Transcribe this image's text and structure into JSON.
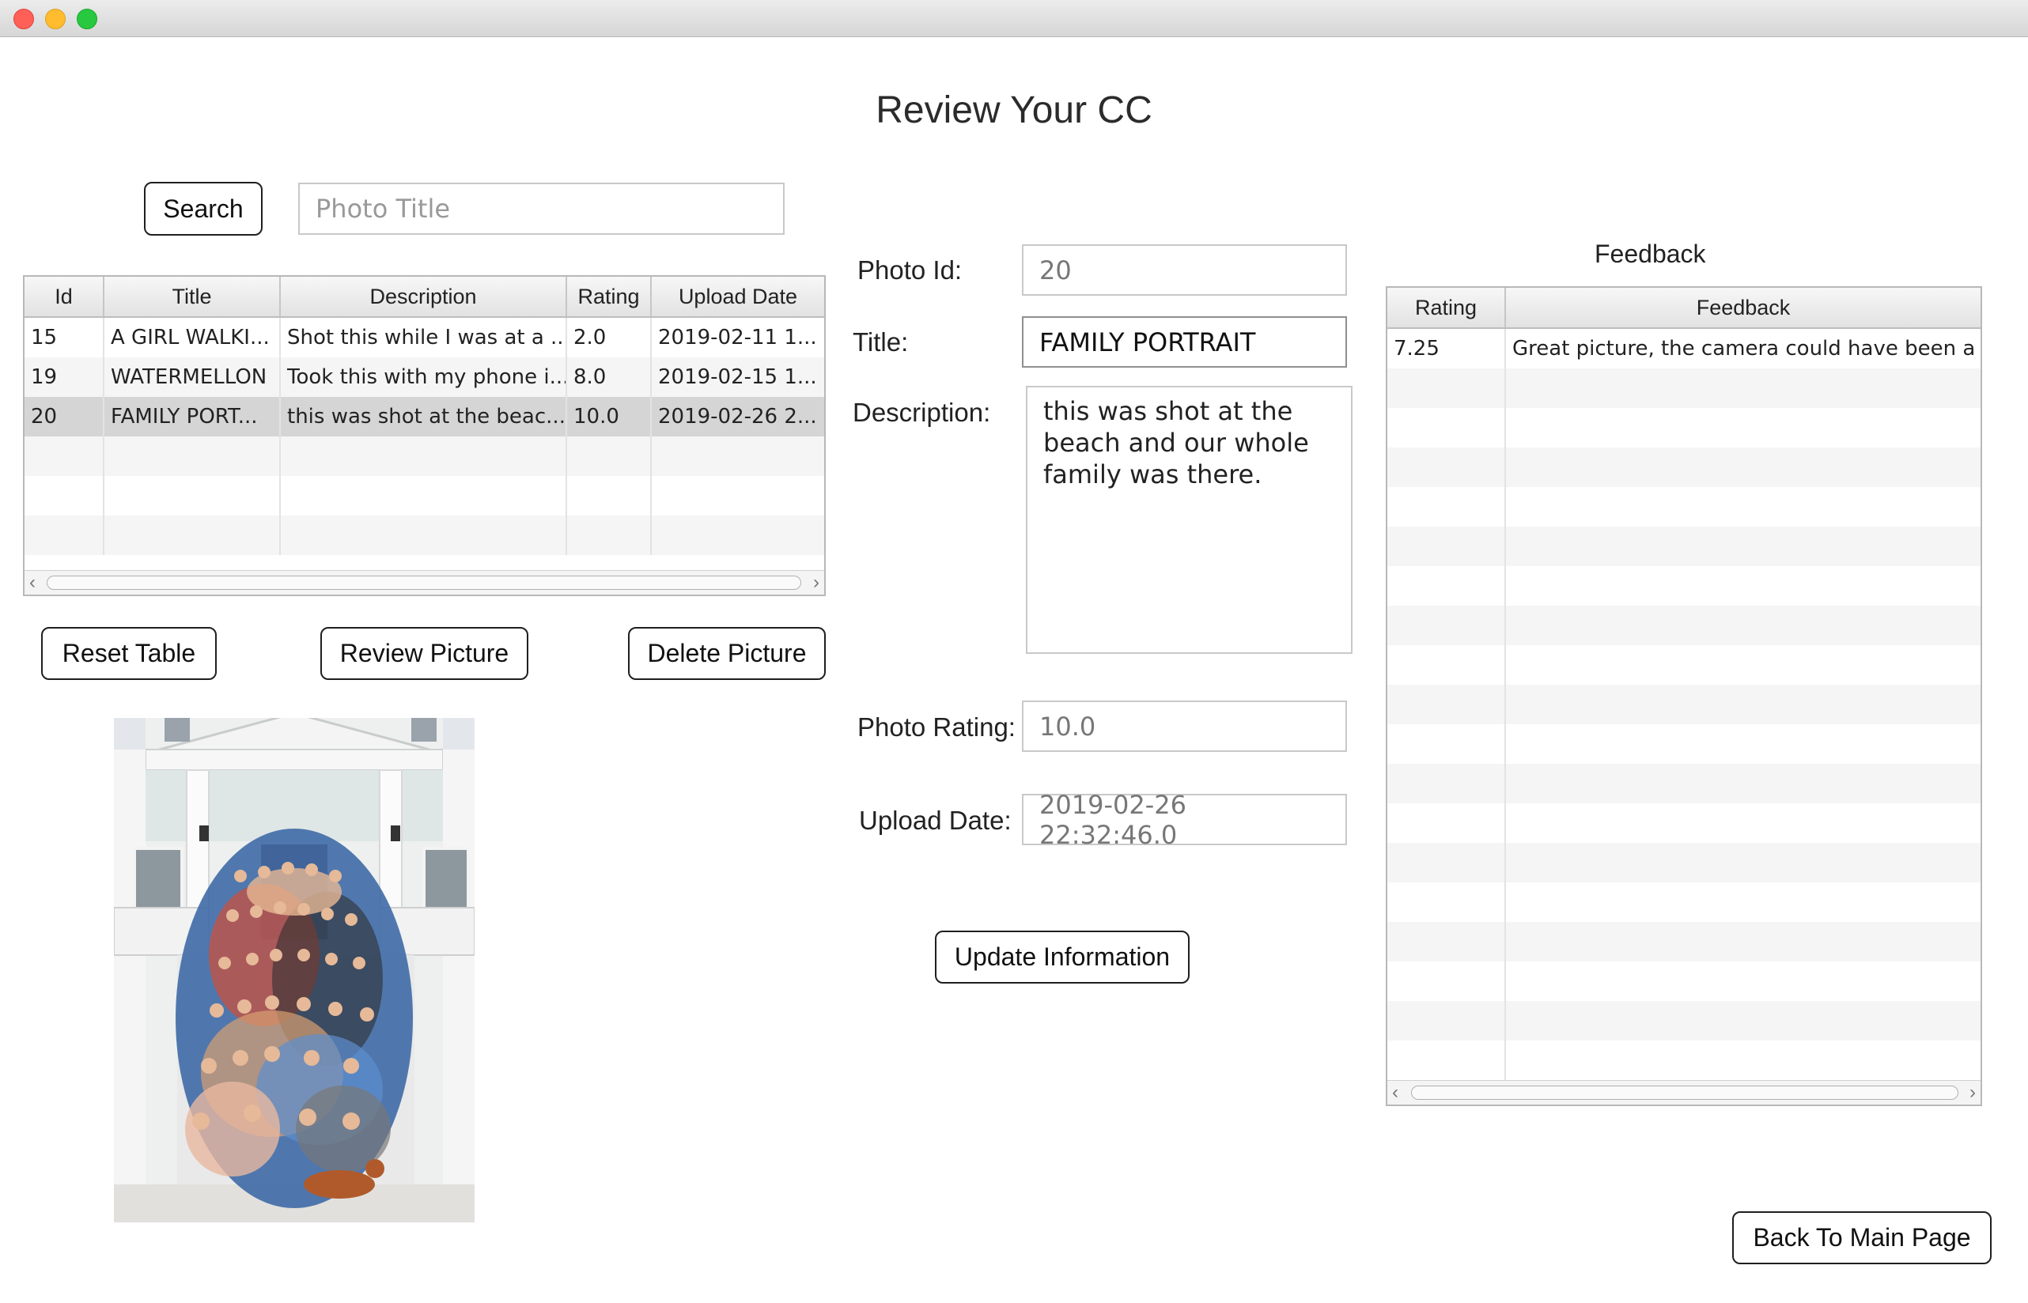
{
  "window": {
    "title": "Review Your CC"
  },
  "search": {
    "button_label": "Search",
    "placeholder": "Photo Title",
    "value": ""
  },
  "photos_table": {
    "columns": [
      "Id",
      "Title",
      "Description",
      "Rating",
      "Upload Date"
    ],
    "rows": [
      {
        "id": "15",
        "title": "A GIRL WALKI...",
        "description": "Shot this while I was at a ...",
        "rating": "2.0",
        "upload_date": "2019-02-11 1..."
      },
      {
        "id": "19",
        "title": "WATERMELLON",
        "description": "Took this with my phone i...",
        "rating": "8.0",
        "upload_date": "2019-02-15 1..."
      },
      {
        "id": "20",
        "title": "FAMILY PORT...",
        "description": "this was shot at the beac...",
        "rating": "10.0",
        "upload_date": "2019-02-26 2..."
      }
    ],
    "selected_row": 2
  },
  "actions": {
    "reset_label": "Reset Table",
    "review_label": "Review Picture",
    "delete_label": "Delete Picture",
    "update_label": "Update Information",
    "back_label": "Back To Main Page"
  },
  "details": {
    "photo_id_label": "Photo Id:",
    "photo_id": "20",
    "title_label": "Title:",
    "title": "FAMILY PORTRAIT",
    "description_label": "Description:",
    "description": "this was shot at the beach and our whole family was there.",
    "rating_label": "Photo Rating:",
    "rating": "10.0",
    "upload_date_label": "Upload Date:",
    "upload_date": "2019-02-26 22:32:46.0"
  },
  "feedback": {
    "heading": "Feedback",
    "columns": [
      "Rating",
      "Feedback"
    ],
    "rows": [
      {
        "rating": "7.25",
        "feedback": "Great picture, the camera could have been a ..."
      }
    ]
  },
  "colors": {
    "selected_row": "#d5d5d5",
    "border": "#1f1f1f"
  }
}
